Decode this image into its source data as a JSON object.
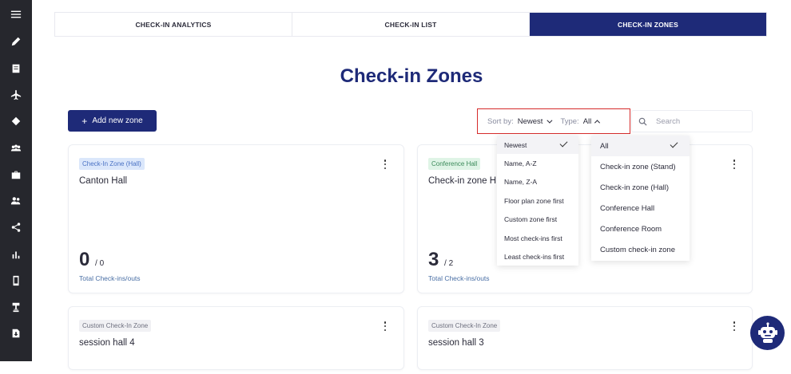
{
  "sidebar": {
    "icons": [
      "menu-icon",
      "pencil-icon",
      "document-icon",
      "airplane-icon",
      "tag-icon",
      "group-icon",
      "briefcase-icon",
      "users-icon",
      "share-icon",
      "bar-chart-icon",
      "mobile-icon",
      "lamp-icon",
      "export-icon"
    ]
  },
  "tabs": [
    {
      "label": "CHECK-IN ANALYTICS",
      "active": false
    },
    {
      "label": "CHECK-IN LIST",
      "active": false
    },
    {
      "label": "CHECK-IN ZONES",
      "active": true
    }
  ],
  "page_title": "Check-in Zones",
  "add_button": {
    "plus": "+",
    "label": "Add new zone"
  },
  "filters": {
    "sort_label": "Sort by:",
    "sort_value": "Newest",
    "type_label": "Type:",
    "type_value": "All",
    "search_placeholder": "Search"
  },
  "sort_options": [
    "Newest",
    "Name, A-Z",
    "Name, Z-A",
    "Floor plan zone first",
    "Custom zone first",
    "Most check-ins first",
    "Least check-ins first"
  ],
  "sort_selected": "Newest",
  "type_options": [
    "All",
    "Check-in zone (Stand)",
    "Check-in zone (Hall)",
    "Conference Hall",
    "Conference Room",
    "Custom check-in zone"
  ],
  "type_selected": "All",
  "cards": [
    {
      "badge": "Check-In Zone (Hall)",
      "name": "Canton Hall",
      "count": "0",
      "total": "/ 0",
      "count_label": "Total Check-ins/outs"
    },
    {
      "badge": "Conference Hall",
      "name": "Check-in zone H",
      "count": "3",
      "total": "/ 2",
      "count_label": "Total Check-ins/outs"
    },
    {
      "badge": "Custom Check-In Zone",
      "name": "session hall 4"
    },
    {
      "badge": "Custom Check-In Zone",
      "name": "session hall 3"
    }
  ],
  "colors": {
    "primary": "#1e2a78",
    "sidebar": "#26272d",
    "highlight_border": "#d62b2b"
  }
}
